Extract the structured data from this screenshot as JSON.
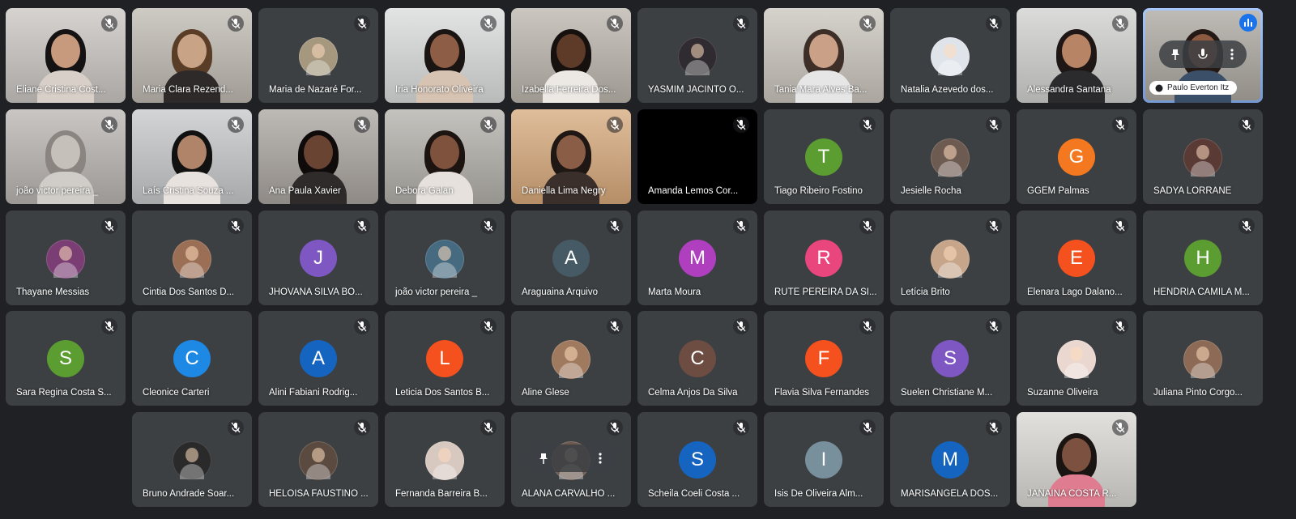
{
  "colors": {
    "background": "#202124",
    "tile": "#3c4043",
    "active_border": "#8ab4f8",
    "speaking_badge": "#1a73e8"
  },
  "participants": [
    {
      "name": "Eliane Cristina Cost...",
      "kind": "video",
      "bg": "#c8c4c0",
      "skin": "#c79a7e",
      "hair": "#151213",
      "shirt": "#d8d0c8",
      "icon": "mic-off-icon"
    },
    {
      "name": "Maria Clara Rezend...",
      "kind": "video",
      "bg": "#bdb8b0",
      "skin": "#c9a385",
      "hair": "#5a3d26",
      "shirt": "#2e2a29",
      "icon": "mic-off-icon"
    },
    {
      "name": "Maria de Nazaré For...",
      "kind": "photo",
      "color": "#a5987f",
      "icon": "mic-off-icon"
    },
    {
      "name": "Iria Honorato Oliveira",
      "kind": "video",
      "bg": "#d9dbda",
      "skin": "#8d5e45",
      "hair": "#1a1412",
      "shirt": "#d7c3b2",
      "icon": "mic-off-icon"
    },
    {
      "name": "Izabella Ferreira Dos...",
      "kind": "video",
      "bg": "#b9b3aa",
      "skin": "#5e3b29",
      "hair": "#16110e",
      "shirt": "#ece8e3",
      "icon": "mic-off-icon"
    },
    {
      "name": "YASMIM JACINTO O...",
      "kind": "photo",
      "color": "#2f2b30",
      "icon": "mic-off-icon"
    },
    {
      "name": "Tania Mara Alves Ba...",
      "kind": "video",
      "bg": "#c8c3bb",
      "skin": "#caa086",
      "hair": "#3d2f28",
      "shirt": "#e6e6e6",
      "icon": "mic-off-icon"
    },
    {
      "name": "Natalia Azevedo dos...",
      "kind": "photo",
      "color": "#dfe3ea",
      "icon": "mic-off-icon"
    },
    {
      "name": "Alessandra Santana",
      "kind": "video",
      "bg": "#cfcfcd",
      "skin": "#b88466",
      "hair": "#1e1715",
      "shirt": "#2b2b2d",
      "icon": "mic-off-icon"
    },
    {
      "name": "Paulo Everton Itz",
      "kind": "video",
      "bg": "#aaa59e",
      "skin": "#8b5a41",
      "hair": "#241914",
      "shirt": "#3c4f68",
      "active": true
    },
    {
      "name": "joão victor pereira _",
      "kind": "video",
      "bg": "#b7b3af",
      "skin": "#c5c0ba",
      "hair": "#8a8580",
      "shirt": "#d0ccc8",
      "icon": "mic-off-icon"
    },
    {
      "name": "Laís Cristina Souza ...",
      "kind": "video",
      "bg": "#c4c6c8",
      "skin": "#b08468",
      "hair": "#111",
      "shirt": "#e8e2de",
      "icon": "mic-off-icon"
    },
    {
      "name": "Ana Paula Xavier",
      "kind": "video",
      "bg": "#a7a29c",
      "skin": "#6a4433",
      "hair": "#0f0b0a",
      "shirt": "#2f2b2a",
      "icon": "mic-off-icon"
    },
    {
      "name": "Debora Galan",
      "kind": "video",
      "bg": "#b1aea8",
      "skin": "#7e523c",
      "hair": "#1b1411",
      "shirt": "#e6e1dc",
      "icon": "mic-off-icon"
    },
    {
      "name": "Daniella Lima Negry",
      "kind": "video",
      "bg": "#d5a779",
      "skin": "#8a5e46",
      "hair": "#1f1713",
      "shirt": "#3a2f2b",
      "icon": "mic-off-icon"
    },
    {
      "name": "Amanda Lemos Cor...",
      "kind": "dark",
      "icon": "mic-off-icon"
    },
    {
      "name": "Tiago Ribeiro Fostino",
      "kind": "letter",
      "letter": "T",
      "color": "#5c9d32",
      "icon": "mic-off-icon"
    },
    {
      "name": "Jesielle Rocha",
      "kind": "photo",
      "color": "#6d5a50",
      "icon": "mic-off-icon"
    },
    {
      "name": "GGEM Palmas",
      "kind": "letter",
      "letter": "G",
      "color": "#f4781f",
      "icon": "mic-off-icon"
    },
    {
      "name": "SADYA LORRANE",
      "kind": "photo",
      "color": "#5a3a35",
      "icon": "mic-off-icon"
    },
    {
      "name": "Thayane Messias",
      "kind": "photo",
      "color": "#7b3e74",
      "icon": "mic-off-icon"
    },
    {
      "name": "Cintia Dos Santos D...",
      "kind": "photo",
      "color": "#9b6f55",
      "icon": "mic-off-icon"
    },
    {
      "name": "JHOVANA SILVA BO...",
      "kind": "letter",
      "letter": "J",
      "color": "#7e57c2",
      "icon": "mic-off-icon"
    },
    {
      "name": "joão victor pereira _",
      "kind": "photo",
      "color": "#466a80",
      "icon": "mic-off-icon"
    },
    {
      "name": "Araguaina Arquivo",
      "kind": "letter",
      "letter": "A",
      "color": "#455a64",
      "icon": "mic-off-icon"
    },
    {
      "name": "Marta Moura",
      "kind": "letter",
      "letter": "M",
      "color": "#b03fc0",
      "icon": "mic-off-icon"
    },
    {
      "name": "RUTE PEREIRA DA SI...",
      "kind": "letter",
      "letter": "R",
      "color": "#e8467c",
      "icon": "mic-off-icon"
    },
    {
      "name": "Letícia Brito",
      "kind": "photo",
      "color": "#c6a58b",
      "icon": "mic-off-icon"
    },
    {
      "name": "Elenara Lago Dalano...",
      "kind": "letter",
      "letter": "E",
      "color": "#f4511e",
      "icon": "mic-off-icon"
    },
    {
      "name": "HENDRIA CAMILA M...",
      "kind": "letter",
      "letter": "H",
      "color": "#5c9d32",
      "icon": "mic-off-icon"
    },
    {
      "name": "Sara Regina Costa S...",
      "kind": "letter",
      "letter": "S",
      "color": "#5c9d32",
      "icon": "mic-off-icon"
    },
    {
      "name": "Cleonice Carteri",
      "kind": "letter",
      "letter": "C",
      "color": "#1e88e5",
      "icon": "none"
    },
    {
      "name": "Alini Fabiani Rodrig...",
      "kind": "letter",
      "letter": "A",
      "color": "#1565c0",
      "icon": "mic-off-icon"
    },
    {
      "name": "Leticia Dos Santos B...",
      "kind": "letter",
      "letter": "L",
      "color": "#f4511e",
      "icon": "mic-off-icon"
    },
    {
      "name": "Aline Glese",
      "kind": "photo",
      "color": "#a07a5e",
      "icon": "mic-off-icon"
    },
    {
      "name": "Celma Anjos Da Silva",
      "kind": "letter",
      "letter": "C",
      "color": "#6d4c41",
      "icon": "mic-off-icon"
    },
    {
      "name": "Flavia Silva Fernandes",
      "kind": "letter",
      "letter": "F",
      "color": "#f4511e",
      "icon": "mic-off-icon"
    },
    {
      "name": "Suelen Christiane M...",
      "kind": "letter",
      "letter": "S",
      "color": "#7e57c2",
      "icon": "mic-off-icon"
    },
    {
      "name": "Suzanne Oliveira",
      "kind": "photo",
      "color": "#e9d7d0",
      "icon": "mic-off-icon"
    },
    {
      "name": "Juliana Pinto Corgo...",
      "kind": "photo",
      "color": "#8c6a55",
      "icon": "none"
    },
    {
      "name": "Bruno Andrade Soar...",
      "kind": "photo",
      "color": "#2a2a2a",
      "icon": "mic-off-icon"
    },
    {
      "name": "HELOISA FAUSTINO ...",
      "kind": "photo",
      "color": "#5b4a3f",
      "icon": "mic-off-icon"
    },
    {
      "name": "Fernanda Barreira B...",
      "kind": "photo",
      "color": "#d7c8c0",
      "icon": "mic-off-icon"
    },
    {
      "name": "ALANA CARVALHO ...",
      "kind": "photo",
      "color": "#6c5a50",
      "icon": "mic-off-icon",
      "hover": true
    },
    {
      "name": "Scheila Coeli Costa ...",
      "kind": "letter",
      "letter": "S",
      "color": "#1565c0",
      "icon": "mic-off-icon"
    },
    {
      "name": "Isis De Oliveira Alm...",
      "kind": "letter",
      "letter": "I",
      "color": "#78909c",
      "icon": "mic-off-icon"
    },
    {
      "name": "MARISANGELA DOS...",
      "kind": "letter",
      "letter": "M",
      "color": "#1565c0",
      "icon": "mic-off-icon"
    },
    {
      "name": "JANAINA COSTA R...",
      "kind": "video",
      "bg": "#d8d6d2",
      "skin": "#7c5140",
      "hair": "#1a1412",
      "shirt": "#e07c8f",
      "icon": "mic-off-icon"
    }
  ]
}
